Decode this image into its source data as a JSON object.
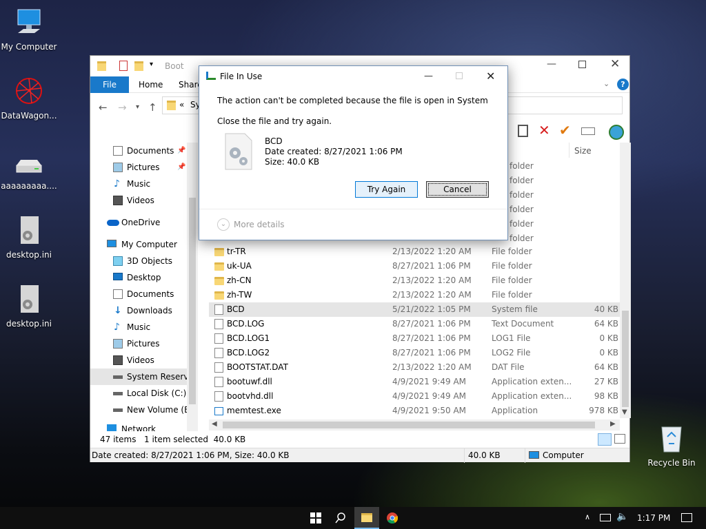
{
  "desktop": {
    "icons": [
      {
        "label": "My Computer"
      },
      {
        "label": "DataWagon..."
      },
      {
        "label": "aaaaaaaaa...."
      },
      {
        "label": "desktop.ini"
      },
      {
        "label": "desktop.ini"
      },
      {
        "label": "Recycle Bin"
      }
    ]
  },
  "explorer": {
    "title": "Boot",
    "tabs": {
      "file": "File",
      "home": "Home",
      "share": "Share"
    },
    "address_crumb": "«",
    "address_text": "Sy",
    "header_size": "Size",
    "nav": [
      {
        "label": "Documents"
      },
      {
        "label": "Pictures"
      },
      {
        "label": "Music"
      },
      {
        "label": "Videos"
      },
      {
        "label": "OneDrive"
      },
      {
        "label": "My Computer"
      },
      {
        "label": "3D Objects"
      },
      {
        "label": "Desktop"
      },
      {
        "label": "Documents"
      },
      {
        "label": "Downloads"
      },
      {
        "label": "Music"
      },
      {
        "label": "Pictures"
      },
      {
        "label": "Videos"
      },
      {
        "label": "System Reserved"
      },
      {
        "label": "Local Disk (C:)"
      },
      {
        "label": "New Volume (E:)"
      },
      {
        "label": "Network"
      }
    ],
    "partial_type_label": "folder",
    "files": [
      {
        "name": "tr-TR",
        "date": "2/13/2022 1:20 AM",
        "type": "File folder",
        "size": ""
      },
      {
        "name": "uk-UA",
        "date": "8/27/2021 1:06 PM",
        "type": "File folder",
        "size": ""
      },
      {
        "name": "zh-CN",
        "date": "2/13/2022 1:20 AM",
        "type": "File folder",
        "size": ""
      },
      {
        "name": "zh-TW",
        "date": "2/13/2022 1:20 AM",
        "type": "File folder",
        "size": ""
      },
      {
        "name": "BCD",
        "date": "5/21/2022 1:05 PM",
        "type": "System file",
        "size": "40 KB"
      },
      {
        "name": "BCD.LOG",
        "date": "8/27/2021 1:06 PM",
        "type": "Text Document",
        "size": "64 KB"
      },
      {
        "name": "BCD.LOG1",
        "date": "8/27/2021 1:06 PM",
        "type": "LOG1 File",
        "size": "0 KB"
      },
      {
        "name": "BCD.LOG2",
        "date": "8/27/2021 1:06 PM",
        "type": "LOG2 File",
        "size": "0 KB"
      },
      {
        "name": "BOOTSTAT.DAT",
        "date": "2/13/2022 1:20 AM",
        "type": "DAT File",
        "size": "64 KB"
      },
      {
        "name": "bootuwf.dll",
        "date": "4/9/2021 9:49 AM",
        "type": "Application exten...",
        "size": "27 KB"
      },
      {
        "name": "bootvhd.dll",
        "date": "4/9/2021 9:49 AM",
        "type": "Application exten...",
        "size": "98 KB"
      },
      {
        "name": "memtest.exe",
        "date": "4/9/2021 9:50 AM",
        "type": "Application",
        "size": "978 KB"
      }
    ],
    "status": {
      "items": "47 items",
      "selected": "1 item selected  40.0 KB"
    },
    "status2": {
      "left": "Date created: 8/27/2021 1:06 PM, Size: 40.0 KB",
      "mid": "40.0 KB",
      "right": "Computer"
    }
  },
  "dialog": {
    "title": "File In Use",
    "message": "The action can't be completed because the file is open in System",
    "instruction": "Close the file and try again.",
    "file_name": "BCD",
    "file_date": "Date created: 8/27/2021 1:06 PM",
    "file_size": "Size: 40.0 KB",
    "try_again": "Try Again",
    "cancel": "Cancel",
    "more_details": "More details"
  },
  "taskbar": {
    "time": "1:17 PM"
  },
  "colors": {
    "accent": "#1979ca",
    "selection": "#e5e5e5",
    "dialog_border": "#6f8fb5"
  }
}
